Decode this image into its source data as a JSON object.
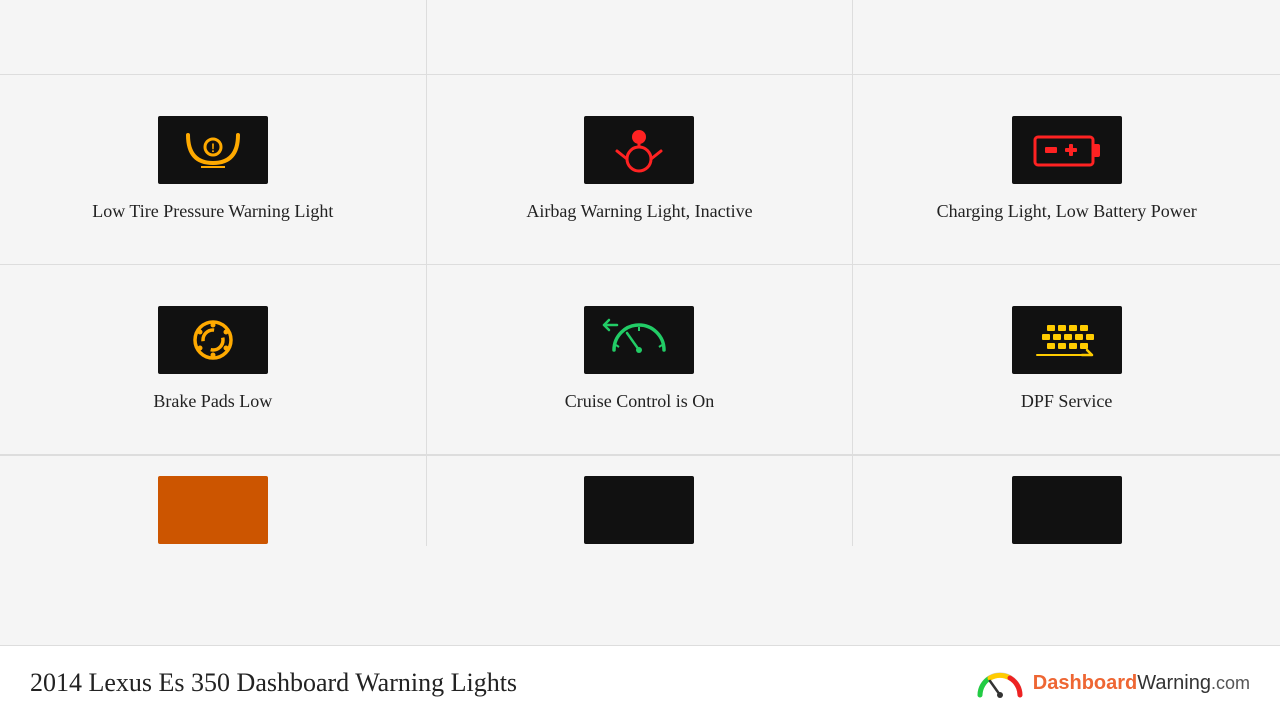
{
  "page": {
    "title": "2014 Lexus Es 350 Dashboard Warning Lights",
    "logo_text": "DashboardWarning.com"
  },
  "top_row": [
    {
      "id": "top-1"
    },
    {
      "id": "top-2"
    },
    {
      "id": "top-3"
    }
  ],
  "grid_cells": [
    {
      "id": "low-tire",
      "label": "Low Tire Pressure Warning Light",
      "icon_color": "#ffaa00",
      "icon_type": "tire-pressure"
    },
    {
      "id": "airbag",
      "label": "Airbag Warning Light, Inactive",
      "icon_color": "#ff2222",
      "icon_type": "airbag"
    },
    {
      "id": "charging",
      "label": "Charging Light, Low Battery Power",
      "icon_color": "#ff2222",
      "icon_type": "battery"
    },
    {
      "id": "brake-pads",
      "label": "Brake Pads Low",
      "icon_color": "#ffaa00",
      "icon_type": "brake"
    },
    {
      "id": "cruise-control",
      "label": "Cruise Control is On",
      "icon_color": "#22cc66",
      "icon_type": "cruise"
    },
    {
      "id": "dpf-service",
      "label": "DPF Service",
      "icon_color": "#ffcc00",
      "icon_type": "dpf"
    }
  ],
  "partial_icons": [
    {
      "bg": "#cc5500"
    },
    {
      "bg": "#111111"
    },
    {
      "bg": "#111111"
    }
  ]
}
